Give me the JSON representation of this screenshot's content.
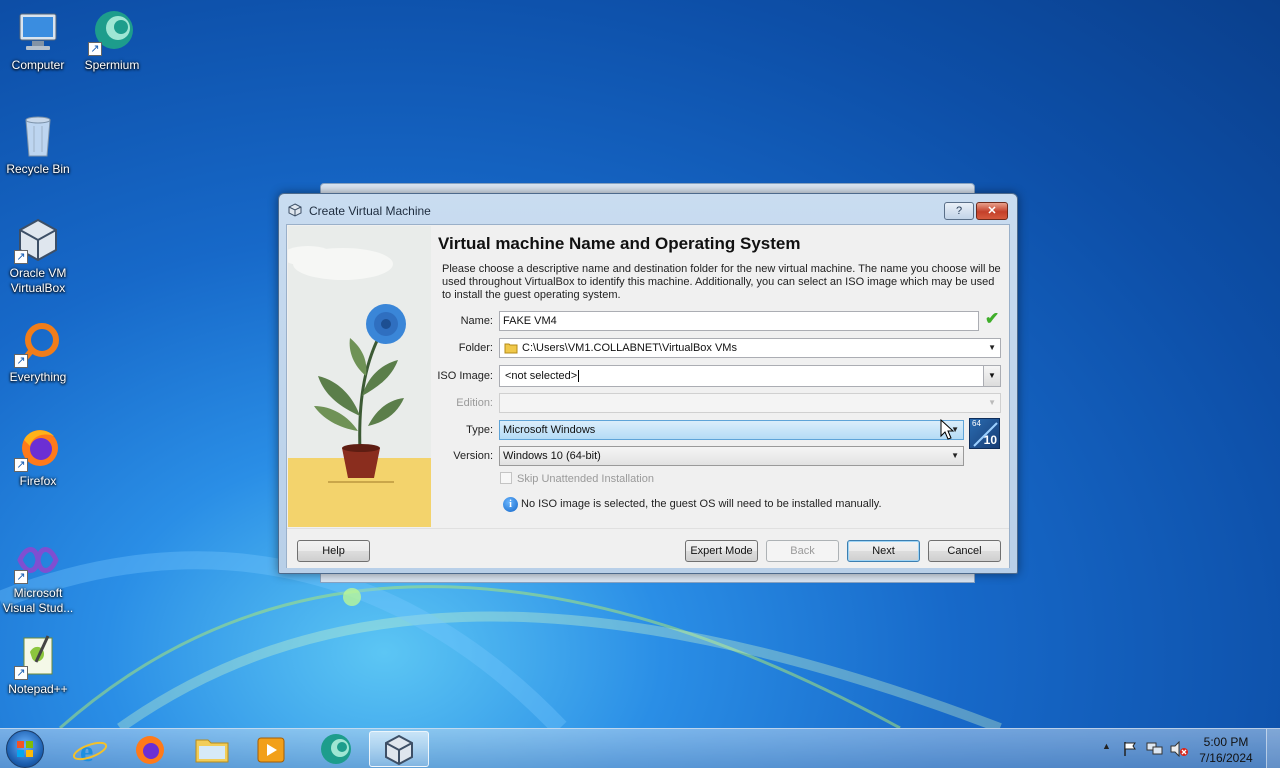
{
  "desktop": {
    "icons": [
      {
        "label": "Computer",
        "icon": "computer-icon"
      },
      {
        "label": "Spermium",
        "icon": "spermium-icon"
      },
      {
        "label": "Recycle Bin",
        "icon": "recycle-bin-icon"
      },
      {
        "label": "Oracle VM VirtualBox",
        "icon": "virtualbox-icon"
      },
      {
        "label": "Everything",
        "icon": "everything-icon"
      },
      {
        "label": "Firefox",
        "icon": "firefox-icon"
      },
      {
        "label": "Microsoft Visual Stud...",
        "icon": "visual-studio-icon"
      },
      {
        "label": "Notepad++",
        "icon": "notepadpp-icon"
      }
    ]
  },
  "dialog": {
    "title": "Create Virtual Machine",
    "help_glyph": "?",
    "close_glyph": "✕",
    "heading": "Virtual machine Name and Operating System",
    "description": "Please choose a descriptive name and destination folder for the new virtual machine. The name you choose will be used throughout VirtualBox to identify this machine. Additionally, you can select an ISO image which may be used to install the guest operating system.",
    "fields": {
      "name_label": "Name:",
      "name_value": "FAKE VM4",
      "folder_label": "Folder:",
      "folder_value": "C:\\Users\\VM1.COLLABNET\\VirtualBox VMs",
      "iso_label": "ISO Image:",
      "iso_value": "<not selected>",
      "edition_label": "Edition:",
      "edition_value": "",
      "type_label": "Type:",
      "type_value": "Microsoft Windows",
      "version_label": "Version:",
      "version_value": "Windows 10 (64-bit)"
    },
    "os_badge": {
      "bits": "64",
      "version": "10"
    },
    "skip_unattended": {
      "label": "Skip Unattended Installation",
      "checked": false
    },
    "info_message": "No ISO image is selected, the guest OS will need to be installed manually.",
    "buttons": {
      "help": "Help",
      "expert_mode": "Expert Mode",
      "back": "Back",
      "next": "Next",
      "cancel": "Cancel"
    }
  },
  "taskbar": {
    "apps": [
      {
        "name": "internet-explorer-icon"
      },
      {
        "name": "firefox-icon"
      },
      {
        "name": "file-explorer-icon"
      },
      {
        "name": "media-player-icon"
      },
      {
        "name": "spermium-icon"
      },
      {
        "name": "virtualbox-icon",
        "active": true
      }
    ],
    "time": "5:00 PM",
    "date": "7/16/2024"
  },
  "colors": {
    "desktop_blue": "#1769c9",
    "dialog_frame": "#b8cfe8",
    "valid_check": "#3fae2a",
    "selected_type": "#b4dcf6"
  }
}
